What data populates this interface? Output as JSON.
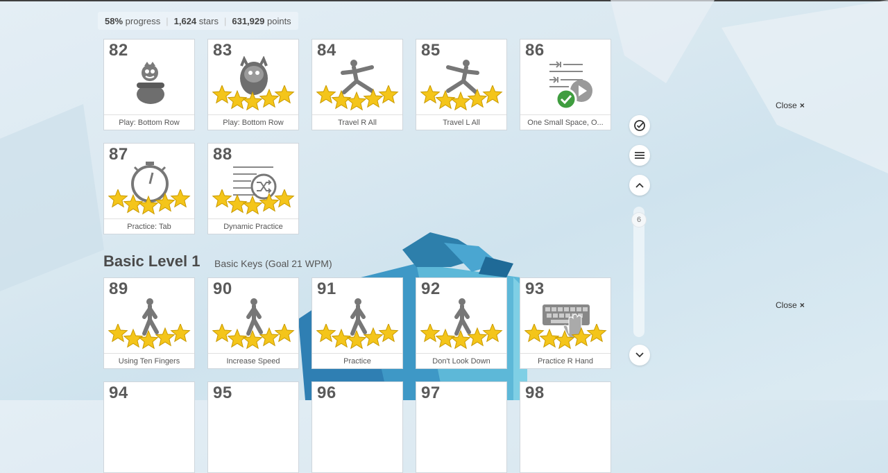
{
  "stats": {
    "progress_value": "58%",
    "progress_label": "progress",
    "stars_value": "1,624",
    "stars_label": "stars",
    "points_value": "631,929",
    "points_label": "points",
    "separator": "|"
  },
  "cards_top": [
    {
      "num": "82",
      "label": "Play: Bottom Row",
      "stars": 0,
      "icon": "character-in-pot-icon"
    },
    {
      "num": "83",
      "label": "Play: Bottom Row",
      "stars": 5,
      "icon": "yeti-character-icon"
    },
    {
      "num": "84",
      "label": "Travel R All",
      "stars": 5,
      "icon": "lunge-figure-icon"
    },
    {
      "num": "85",
      "label": "Travel L All",
      "stars": 5,
      "icon": "lunge-figure-icon"
    },
    {
      "num": "86",
      "label": "One Small Space, O...",
      "stars": 0,
      "icon": "video-lesson-check-icon"
    },
    {
      "num": "87",
      "label": "Practice: Tab",
      "stars": 5,
      "icon": "stopwatch-icon"
    },
    {
      "num": "88",
      "label": "Dynamic Practice",
      "stars": 5,
      "icon": "shuffle-list-icon"
    }
  ],
  "section": {
    "title": "Basic Level 1",
    "subtitle": "Basic Keys (Goal 21 WPM)"
  },
  "cards_bottom": [
    {
      "num": "89",
      "label": "Using Ten Fingers",
      "stars": 5,
      "icon": "walking-figure-icon"
    },
    {
      "num": "90",
      "label": "Increase Speed",
      "stars": 5,
      "icon": "walking-figure-icon"
    },
    {
      "num": "91",
      "label": "Practice",
      "stars": 5,
      "icon": "walking-figure-icon"
    },
    {
      "num": "92",
      "label": "Don't Look Down",
      "stars": 5,
      "icon": "walking-figure-icon"
    },
    {
      "num": "93",
      "label": "Practice R Hand",
      "stars": 5,
      "icon": "keyboard-hand-icon"
    }
  ],
  "cards_partial": [
    "94",
    "95",
    "96",
    "97",
    "98"
  ],
  "sidebar": {
    "scroll_indicator": "6"
  },
  "close_links": [
    {
      "label": "Close",
      "symbol": "×"
    },
    {
      "label": "Close",
      "symbol": "×"
    }
  ],
  "colors": {
    "star": "#f4c51a",
    "star_stroke": "#c99a00",
    "accent_dark": "#4a4a4a"
  }
}
